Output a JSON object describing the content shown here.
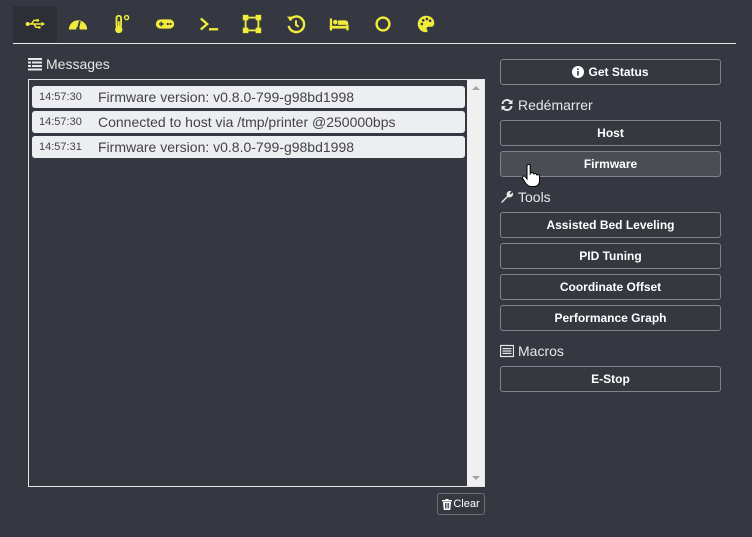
{
  "nav": {
    "tabs": [
      {
        "name": "usb",
        "icon": "usb-icon",
        "active": true
      },
      {
        "name": "dashboard",
        "icon": "tachometer-icon",
        "active": false
      },
      {
        "name": "temperature",
        "icon": "thermometer-icon",
        "active": false
      },
      {
        "name": "control",
        "icon": "gamepad-icon",
        "active": false
      },
      {
        "name": "console",
        "icon": "terminal-icon",
        "active": false
      },
      {
        "name": "bed-mesh",
        "icon": "vector-square-icon",
        "active": false
      },
      {
        "name": "history",
        "icon": "history-icon",
        "active": false
      },
      {
        "name": "bed",
        "icon": "bed-icon",
        "active": false
      },
      {
        "name": "circle",
        "icon": "circle-icon",
        "active": false
      },
      {
        "name": "theme",
        "icon": "palette-icon",
        "active": false
      }
    ],
    "icon_color": "#f0ec3c"
  },
  "messages": {
    "title": "Messages",
    "items": [
      {
        "time": "14:57:30",
        "text": "Firmware version: v0.8.0-799-g98bd1998"
      },
      {
        "time": "14:57:30",
        "text": "Connected to host via /tmp/printer @250000bps"
      },
      {
        "time": "14:57:31",
        "text": "Firmware version: v0.8.0-799-g98bd1998"
      }
    ],
    "clear_label": "Clear"
  },
  "side": {
    "get_status": "Get Status",
    "restart_title": "Redémarrer",
    "host": "Host",
    "firmware": "Firmware",
    "tools_title": "Tools",
    "tools": [
      "Assisted Bed Leveling",
      "PID Tuning",
      "Coordinate Offset",
      "Performance Graph"
    ],
    "macros_title": "Macros",
    "macros": [
      "E-Stop"
    ]
  }
}
